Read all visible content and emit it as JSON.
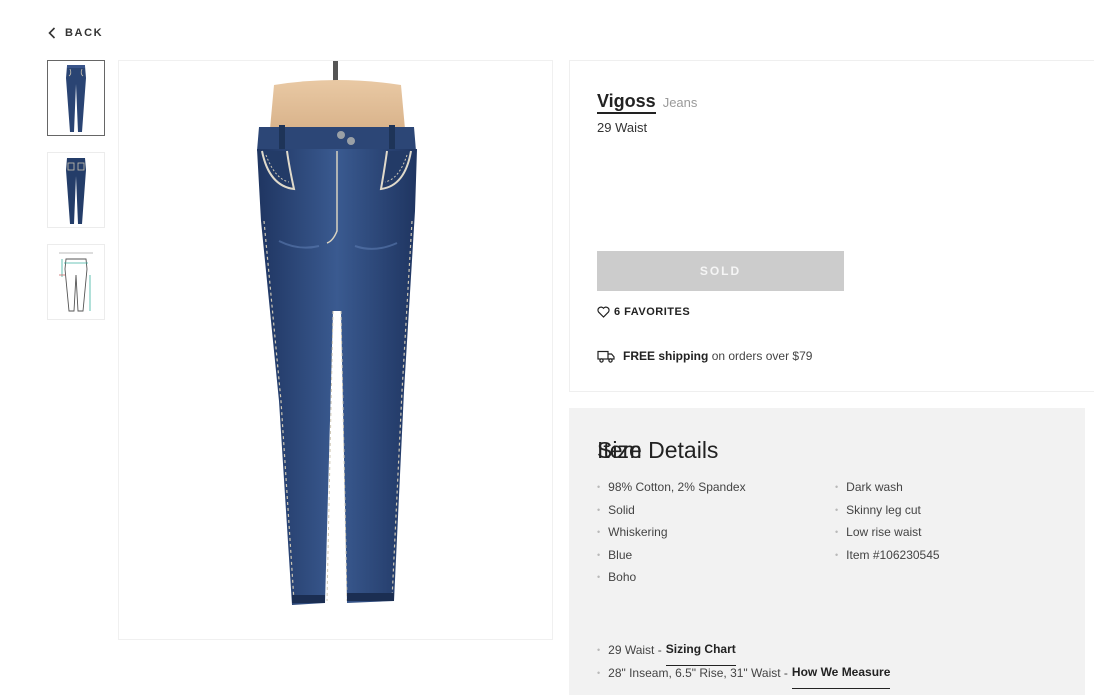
{
  "nav": {
    "back_label": "BACK"
  },
  "gallery": {
    "thumbnails": [
      {
        "kind": "front-photo"
      },
      {
        "kind": "back-photo"
      },
      {
        "kind": "measurement-diagram"
      }
    ],
    "selected_index": 0
  },
  "product": {
    "brand": "Vigoss",
    "category": "Jeans",
    "size_line": "29 Waist",
    "status_button": "SOLD",
    "favorites_label": "6 FAVORITES",
    "shipping_bold": "FREE shipping",
    "shipping_rest": "on orders over $79"
  },
  "item_details": {
    "title": "Item Details",
    "left_column": [
      "98% Cotton, 2% Spandex",
      "Solid",
      "Whiskering",
      "Blue",
      "Boho"
    ],
    "right_column": [
      "Dark wash",
      "Skinny leg cut",
      "Low rise waist",
      "Item #106230545"
    ]
  },
  "size_section": {
    "title": "Size",
    "line1_text": "29 Waist -",
    "line1_link": "Sizing Chart",
    "line2_text": "28\" Inseam, 6.5\" Rise, 31\" Waist -",
    "line2_link": "How We Measure"
  },
  "colors": {
    "denim": "#2a4473",
    "sold_button": "#cccccc",
    "details_bg": "#f2f2f2"
  }
}
